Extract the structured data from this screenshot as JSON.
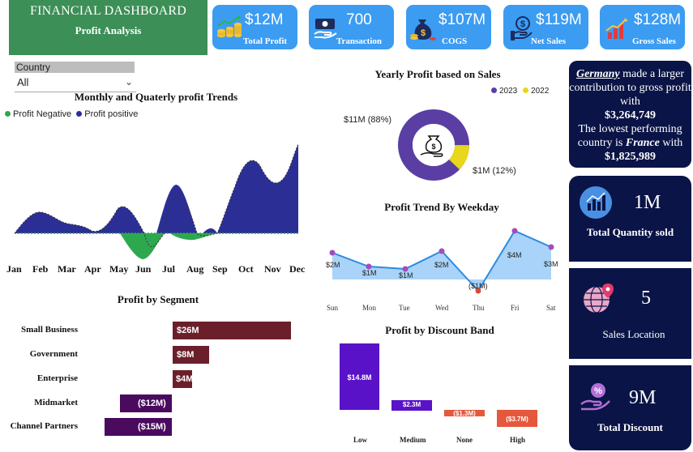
{
  "header": {
    "title": "FINANCIAL DASHBOARD",
    "subtitle": "Profit Analysis"
  },
  "kpis": [
    {
      "value": "$12M",
      "label": "Total Profit",
      "icon": "coins-growth-icon"
    },
    {
      "value": "700",
      "label": "Transaction",
      "icon": "cash-transfer-icon"
    },
    {
      "value": "$107M",
      "label": "COGS",
      "icon": "money-bag-icon"
    },
    {
      "value": "$119M",
      "label": "Net Sales",
      "icon": "hand-dollar-icon"
    },
    {
      "value": "$128M",
      "label": "Gross Sales",
      "icon": "bar-growth-icon"
    }
  ],
  "slicer": {
    "label": "Country",
    "selected": "All"
  },
  "monthly": {
    "title": "Monthly and Quaterly profit Trends",
    "legend_negative": "Profit Negative",
    "legend_positive": "Profit positive",
    "colors": {
      "negative": "#2ea84f",
      "positive": "#2b2f95"
    },
    "months": [
      "Jan",
      "Feb",
      "Mar",
      "Apr",
      "May",
      "Jun",
      "Jul",
      "Aug",
      "Sep",
      "Oct",
      "Nov",
      "Dec"
    ]
  },
  "yearly": {
    "title": "Yearly Profit based on Sales",
    "legend": [
      {
        "name": "2023",
        "color": "#5b3ea4"
      },
      {
        "name": "2022",
        "color": "#e8d71b"
      }
    ],
    "label_2023": "$11M (88%)",
    "label_2022": "$1M (12%)"
  },
  "weekday": {
    "title": "Profit Trend By Weekday",
    "days": [
      "Sun",
      "Mon",
      "Tue",
      "Wed",
      "Thu",
      "Fri",
      "Sat"
    ],
    "labels": [
      "$2M",
      "$1M",
      "$1M",
      "$2M",
      "($1M)",
      "$4M",
      "$3M"
    ]
  },
  "segment": {
    "title": "Profit by Segment",
    "items": [
      {
        "name": "Small Business",
        "label": "$26M",
        "color": "#6b1f2a"
      },
      {
        "name": "Government",
        "label": "$8M",
        "color": "#6b1f2a"
      },
      {
        "name": "Enterprise",
        "label": "$4M",
        "color": "#6b1f2a"
      },
      {
        "name": "Midmarket",
        "label": "($12M)",
        "color": "#4a0a5e"
      },
      {
        "name": "Channel Partners",
        "label": "($15M)",
        "color": "#4a0a5e"
      }
    ]
  },
  "discount": {
    "title": "Profit by Discount Band",
    "bands": [
      "Low",
      "Medium",
      "None",
      "High"
    ],
    "labels": [
      "$14.8M",
      "$2.3M",
      "($1.3M)",
      "($3.7M)"
    ]
  },
  "insight": {
    "country_top": "Germany",
    "line1": "made a larger contribution to gross profit with",
    "top_value": "$3,264,749",
    "line2": "The lowest performing country is",
    "country_low": "France",
    "line3": "with",
    "low_value": "$1,825,989"
  },
  "stats": [
    {
      "value": "1M",
      "label": "Total Quantity sold",
      "icon": "bar-chart-icon"
    },
    {
      "value": "5",
      "label": "Sales Location",
      "icon": "globe-pin-icon"
    },
    {
      "value": "9M",
      "label": "Total Discount",
      "icon": "discount-hand-icon"
    }
  ],
  "chart_data": [
    {
      "type": "area",
      "title": "Monthly and Quaterly profit Trends",
      "categories": [
        "Jan",
        "Feb",
        "Mar",
        "Apr",
        "May",
        "Jun",
        "Jul",
        "Aug",
        "Sep",
        "Oct",
        "Nov",
        "Dec"
      ],
      "legend": "top-left",
      "series": [
        {
          "name": "Profit positive",
          "values": [
            1.0,
            1.2,
            0.5,
            0.1,
            0.9,
            -1.0,
            1.8,
            -0.3,
            1.0,
            2.6,
            1.4,
            3.2
          ]
        }
      ]
    },
    {
      "type": "pie",
      "title": "Yearly Profit based on Sales",
      "categories": [
        "2023",
        "2022"
      ],
      "values": [
        11,
        1
      ],
      "percent": [
        88,
        12
      ],
      "legend": "top-right"
    },
    {
      "type": "line",
      "title": "Profit Trend By Weekday",
      "categories": [
        "Sun",
        "Mon",
        "Tue",
        "Wed",
        "Thu",
        "Fri",
        "Sat"
      ],
      "values": [
        2,
        1,
        1,
        2,
        -1,
        4,
        3
      ],
      "ylim": [
        -1.5,
        4.5
      ]
    },
    {
      "type": "bar",
      "title": "Profit by Segment",
      "categories": [
        "Small Business",
        "Government",
        "Enterprise",
        "Midmarket",
        "Channel Partners"
      ],
      "values": [
        26,
        8,
        4,
        -12,
        -15
      ],
      "orientation": "horizontal"
    },
    {
      "type": "bar",
      "title": "Profit by Discount Band",
      "categories": [
        "Low",
        "Medium",
        "None",
        "High"
      ],
      "values": [
        14.8,
        2.3,
        -1.3,
        -3.7
      ]
    }
  ]
}
